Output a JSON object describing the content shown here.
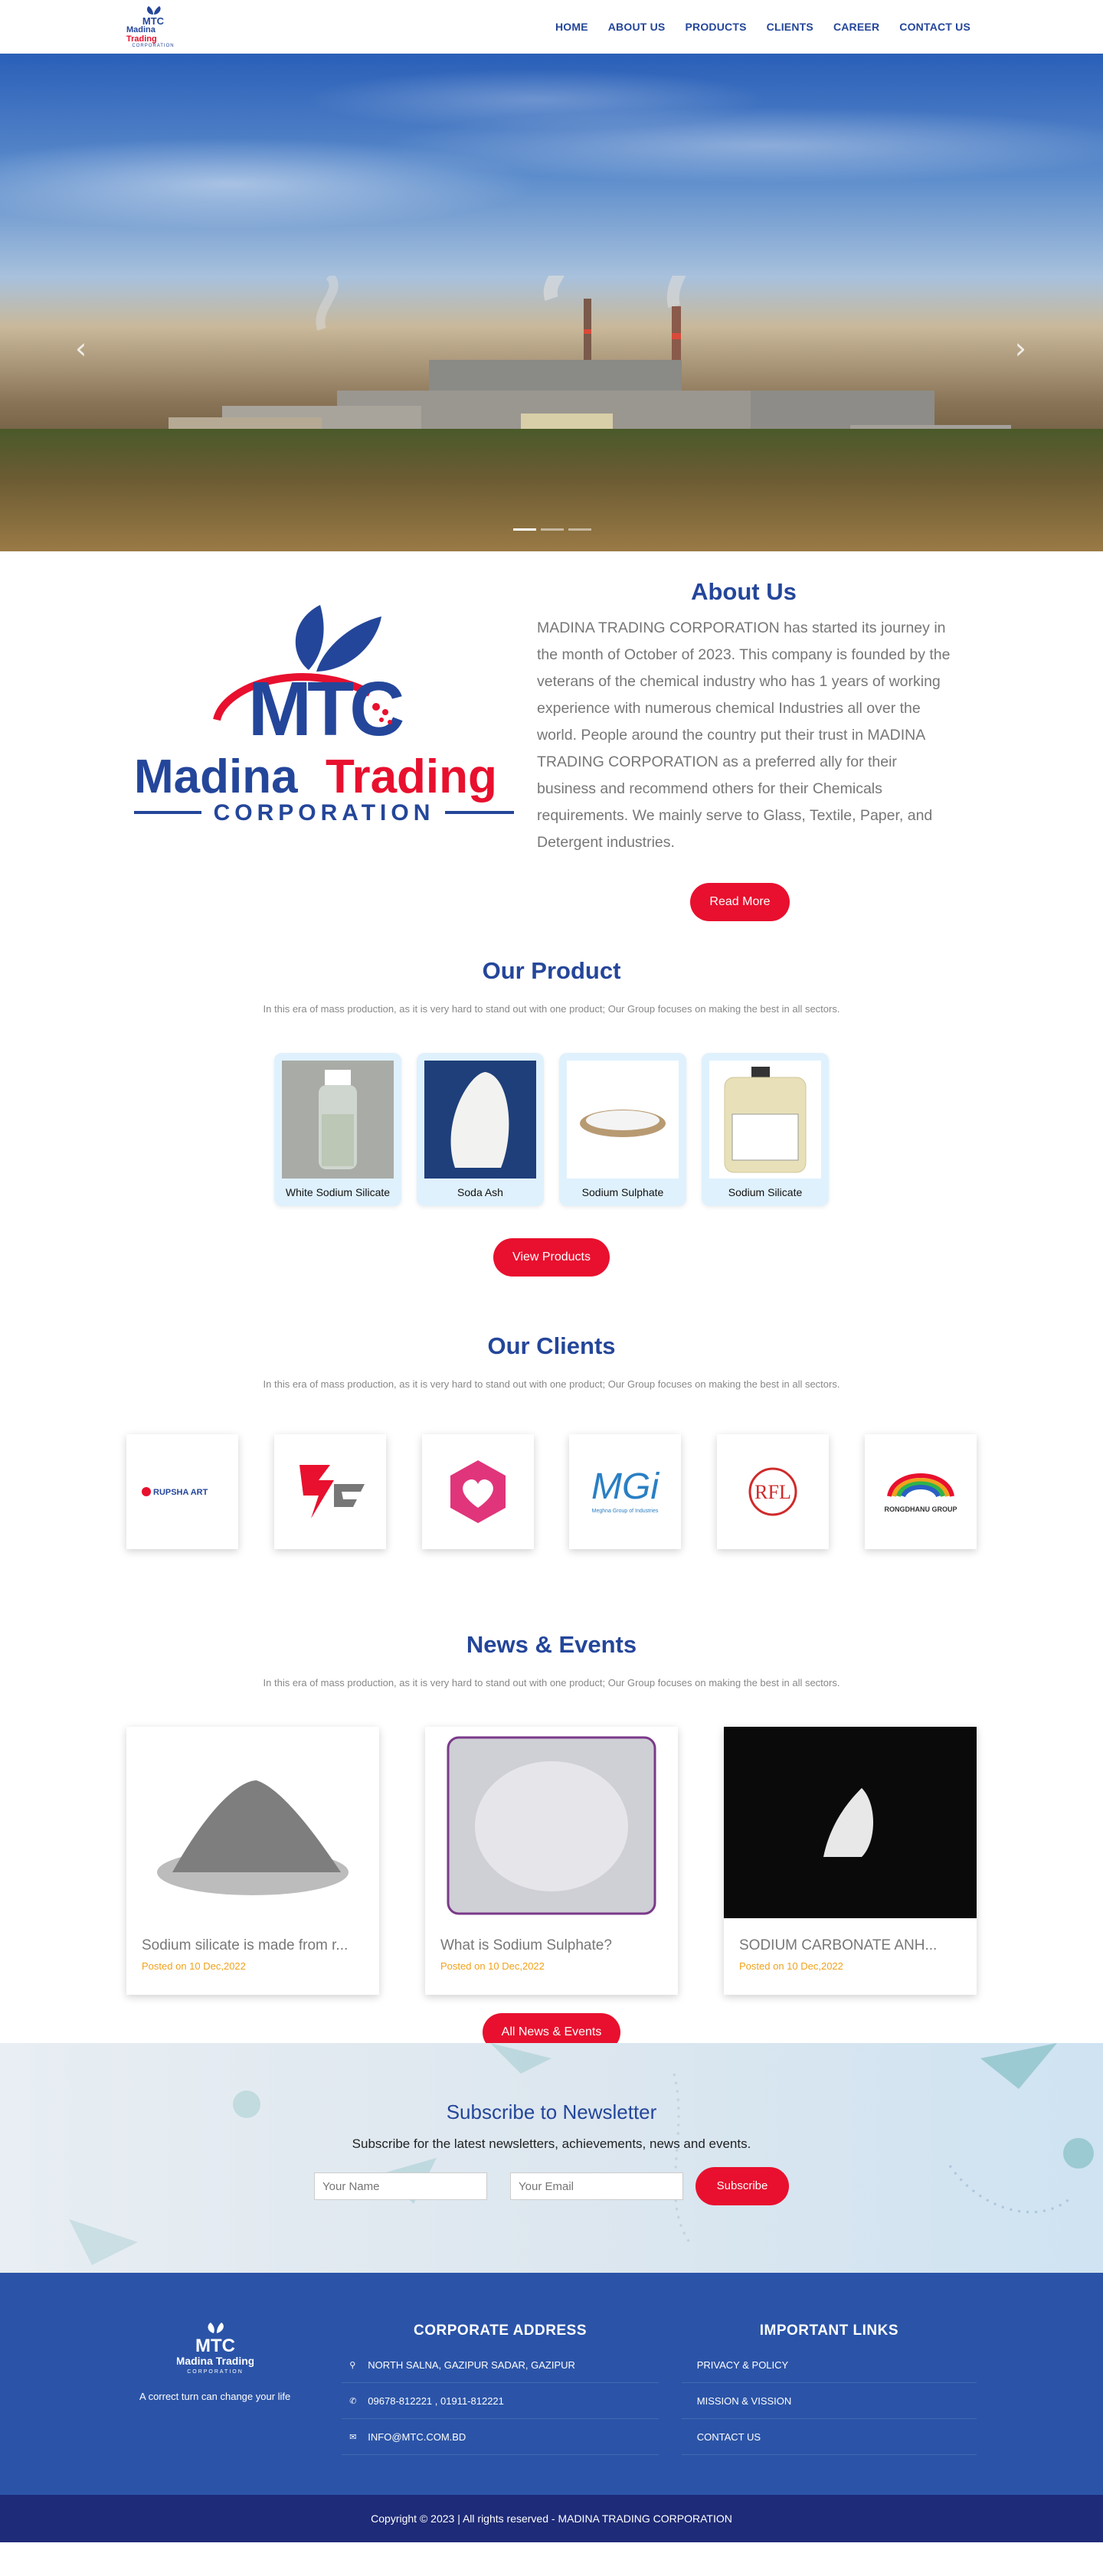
{
  "nav": {
    "logo": {
      "mark": "MTC",
      "name_blue": "Madina",
      "name_red": "Trading",
      "corp": "CORPORATION"
    },
    "items": [
      {
        "label": "HOME"
      },
      {
        "label": "ABOUT US"
      },
      {
        "label": "PRODUCTS"
      },
      {
        "label": "CLIENTS"
      },
      {
        "label": "CAREER"
      },
      {
        "label": "CONTACT US"
      }
    ]
  },
  "hero": {
    "prev_icon": "chevron-left-icon",
    "next_icon": "chevron-right-icon",
    "slides": 3,
    "active_slide": 1
  },
  "about": {
    "title": "About Us",
    "logo": {
      "mark": "MTC",
      "name_blue": "Madina",
      "name_red": "Trading",
      "corp": "CORPORATION"
    },
    "body": "MADINA TRADING CORPORATION has started its journey in the month of October of 2023. This company is founded by the veterans of the chemical industry who has 1 years of working experience with numerous chemical Industries all over the world. People around the country put their trust in MADINA TRADING CORPORATION as a preferred ally for their business and recommend others for their Chemicals requirements. We mainly serve to Glass, Textile, Paper, and Detergent industries.",
    "button": "Read More"
  },
  "products": {
    "title": "Our Product",
    "subtitle": "In this era of mass production, as it is very hard to stand out with one product; Our Group focuses on making the best in all sectors.",
    "items": [
      {
        "name": "White Sodium Silicate"
      },
      {
        "name": "Soda Ash"
      },
      {
        "name": "Sodium Sulphate"
      },
      {
        "name": "Sodium Silicate"
      }
    ],
    "button": "View Products"
  },
  "clients": {
    "title": "Our Clients",
    "subtitle": "In this era of mass production, as it is very hard to stand out with one product; Our Group focuses on making the best in all sectors.",
    "items": [
      {
        "label": "RUPSHA ART"
      },
      {
        "label": ""
      },
      {
        "label": ""
      },
      {
        "label": "MGi",
        "tagline": "Meghna Group of Industries"
      },
      {
        "label": "RFL"
      },
      {
        "label": "RONGDHANU GROUP"
      }
    ]
  },
  "news": {
    "title": "News & Events",
    "subtitle": "In this era of mass production, as it is very hard to stand out with one product; Our Group focuses on making the best in all sectors.",
    "items": [
      {
        "title": "Sodium silicate is made from r...",
        "date": "Posted on 10 Dec,2022"
      },
      {
        "title": "What is Sodium Sulphate?",
        "date": "Posted on 10 Dec,2022"
      },
      {
        "title": "SODIUM CARBONATE ANH...",
        "date": "Posted on 10 Dec,2022"
      }
    ],
    "button": "All News & Events"
  },
  "newsletter": {
    "title": "Subscribe to Newsletter",
    "lead": "Subscribe for the latest newsletters, achievements, news and events.",
    "name_placeholder": "Your Name",
    "email_placeholder": "Your Email",
    "button": "Subscribe"
  },
  "footer": {
    "logo": {
      "mark": "MTC",
      "name": "Madina Trading",
      "corp": "CORPORATION"
    },
    "tagline": "A correct turn can change your life",
    "address_title": "CORPORATE ADDRESS",
    "address": "NORTH SALNA, GAZIPUR SADAR, GAZIPUR",
    "phone": "09678-812221 , 01911-812221",
    "email": "INFO@MTC.COM.BD",
    "links_title": "IMPORTANT LINKS",
    "links": [
      {
        "label": "PRIVACY & POLICY"
      },
      {
        "label": "MISSION & VISSION"
      },
      {
        "label": "CONTACT US"
      }
    ]
  },
  "copyright": "Copyright © 2023 | All rights reserved - MADINA TRADING CORPORATION",
  "colors": {
    "brand_blue": "#24469a",
    "brand_red": "#e8102e",
    "footer_bg": "#2b54a8",
    "copyright_bg": "#1e2b78",
    "date_orange": "#f0a21c"
  }
}
